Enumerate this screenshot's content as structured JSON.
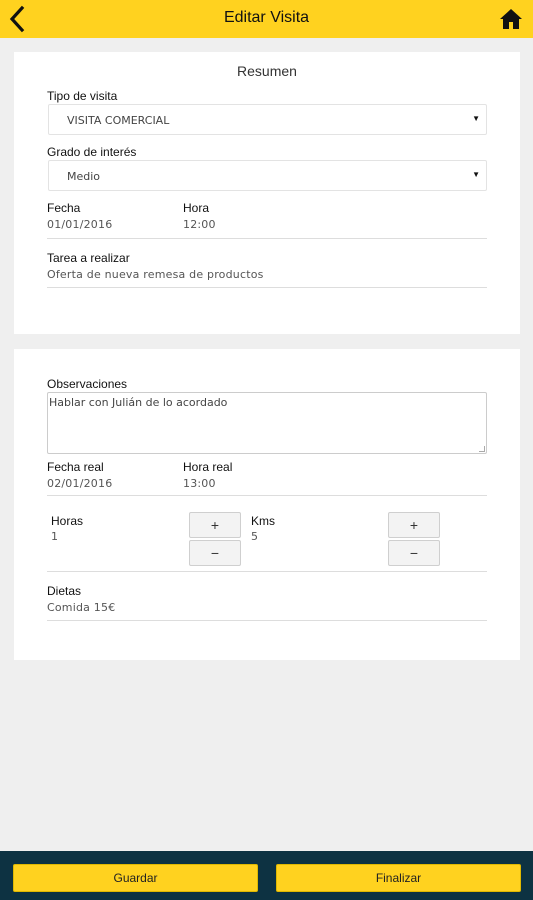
{
  "header": {
    "title": "Editar Visita",
    "back_icon": "chevron-left-icon",
    "home_icon": "home-icon",
    "color": "#ffd21f"
  },
  "summary": {
    "title": "Resumen",
    "tipo_label": "Tipo de visita",
    "tipo_value": "VISITA COMERCIAL",
    "grado_label": "Grado de interés",
    "grado_value": "Medio",
    "fecha_label": "Fecha",
    "fecha_value": "01/01/2016",
    "hora_label": "Hora",
    "hora_value": "12:00",
    "tarea_label": "Tarea a realizar",
    "tarea_value": "Oferta de nueva remesa de productos"
  },
  "details": {
    "obs_label": "Observaciones",
    "obs_value": "Hablar con Julián de lo acordado",
    "fecha_real_label": "Fecha real",
    "fecha_real_value": "02/01/2016",
    "hora_real_label": "Hora real",
    "hora_real_value": "13:00",
    "horas_label": "Horas",
    "horas_value": "1",
    "kms_label": "Kms",
    "kms_value": "5",
    "plus": "+",
    "minus": "−",
    "dietas_label": "Dietas",
    "dietas_value": "Comida 15€"
  },
  "footer": {
    "guardar": "Guardar",
    "finalizar": "Finalizar",
    "bar_color": "#0d3242"
  }
}
